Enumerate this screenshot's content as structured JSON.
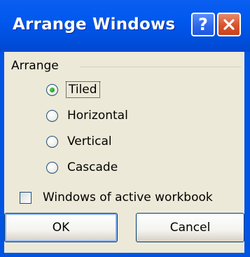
{
  "window": {
    "title": "Arrange Windows",
    "help_icon": "?",
    "close_icon": "close-x"
  },
  "group": {
    "label": "Arrange"
  },
  "options": [
    {
      "label": "Tiled",
      "selected": true
    },
    {
      "label": "Horizontal",
      "selected": false
    },
    {
      "label": "Vertical",
      "selected": false
    },
    {
      "label": "Cascade",
      "selected": false
    }
  ],
  "checkbox": {
    "label": "Windows of active workbook",
    "checked": false
  },
  "buttons": {
    "ok": "OK",
    "cancel": "Cancel"
  },
  "colors": {
    "titlebar": "#0054e3",
    "client": "#ece9d8",
    "close_button": "#d8522c"
  }
}
